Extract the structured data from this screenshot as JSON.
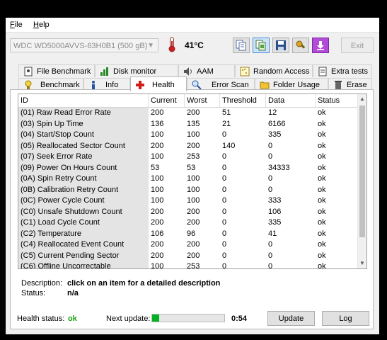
{
  "menu": {
    "file": "File",
    "help": "Help"
  },
  "toolbar": {
    "drive": "WDC WD5000AVVS-63H0B1 (500 gB)",
    "temperature": "41°C",
    "exit": "Exit",
    "buttons": [
      "copy-text-icon",
      "copy-screenshot-icon",
      "save-icon",
      "tools-icon",
      "download-icon"
    ]
  },
  "tabs_top": [
    "File Benchmark",
    "Disk monitor",
    "AAM",
    "Random Access",
    "Extra tests"
  ],
  "tabs_bottom": [
    "Benchmark",
    "Info",
    "Health",
    "Error Scan",
    "Folder Usage",
    "Erase"
  ],
  "selected_tab": "Health",
  "table": {
    "columns": [
      "ID",
      "Current",
      "Worst",
      "Threshold",
      "Data",
      "Status"
    ],
    "rows": [
      [
        "(01) Raw Read Error Rate",
        "200",
        "200",
        "51",
        "12",
        "ok"
      ],
      [
        "(03) Spin Up Time",
        "136",
        "135",
        "21",
        "6166",
        "ok"
      ],
      [
        "(04) Start/Stop Count",
        "100",
        "100",
        "0",
        "335",
        "ok"
      ],
      [
        "(05) Reallocated Sector Count",
        "200",
        "200",
        "140",
        "0",
        "ok"
      ],
      [
        "(07) Seek Error Rate",
        "100",
        "253",
        "0",
        "0",
        "ok"
      ],
      [
        "(09) Power On Hours Count",
        "53",
        "53",
        "0",
        "34333",
        "ok"
      ],
      [
        "(0A) Spin Retry Count",
        "100",
        "100",
        "0",
        "0",
        "ok"
      ],
      [
        "(0B) Calibration Retry Count",
        "100",
        "100",
        "0",
        "0",
        "ok"
      ],
      [
        "(0C) Power Cycle Count",
        "100",
        "100",
        "0",
        "333",
        "ok"
      ],
      [
        "(C0) Unsafe Shutdown Count",
        "200",
        "200",
        "0",
        "106",
        "ok"
      ],
      [
        "(C1) Load Cycle Count",
        "200",
        "200",
        "0",
        "335",
        "ok"
      ],
      [
        "(C2) Temperature",
        "106",
        "96",
        "0",
        "41",
        "ok"
      ],
      [
        "(C4) Reallocated Event Count",
        "200",
        "200",
        "0",
        "0",
        "ok"
      ],
      [
        "(C5) Current Pending Sector",
        "200",
        "200",
        "0",
        "0",
        "ok"
      ],
      [
        "(C6) Offline Uncorrectable",
        "100",
        "253",
        "0",
        "0",
        "ok"
      ]
    ]
  },
  "description": {
    "label": "Description:",
    "value": "click on an item for a detailed description",
    "status_label": "Status:",
    "status_value": "n/a"
  },
  "footer": {
    "health_label": "Health status:",
    "health_value": "ok",
    "next_update_label": "Next update:",
    "progress_fraction": 0.1,
    "countdown": "0:54",
    "update_button": "Update",
    "log_button": "Log"
  },
  "colors": {
    "health_ok": "#13a10e",
    "progress": "#06b025"
  }
}
